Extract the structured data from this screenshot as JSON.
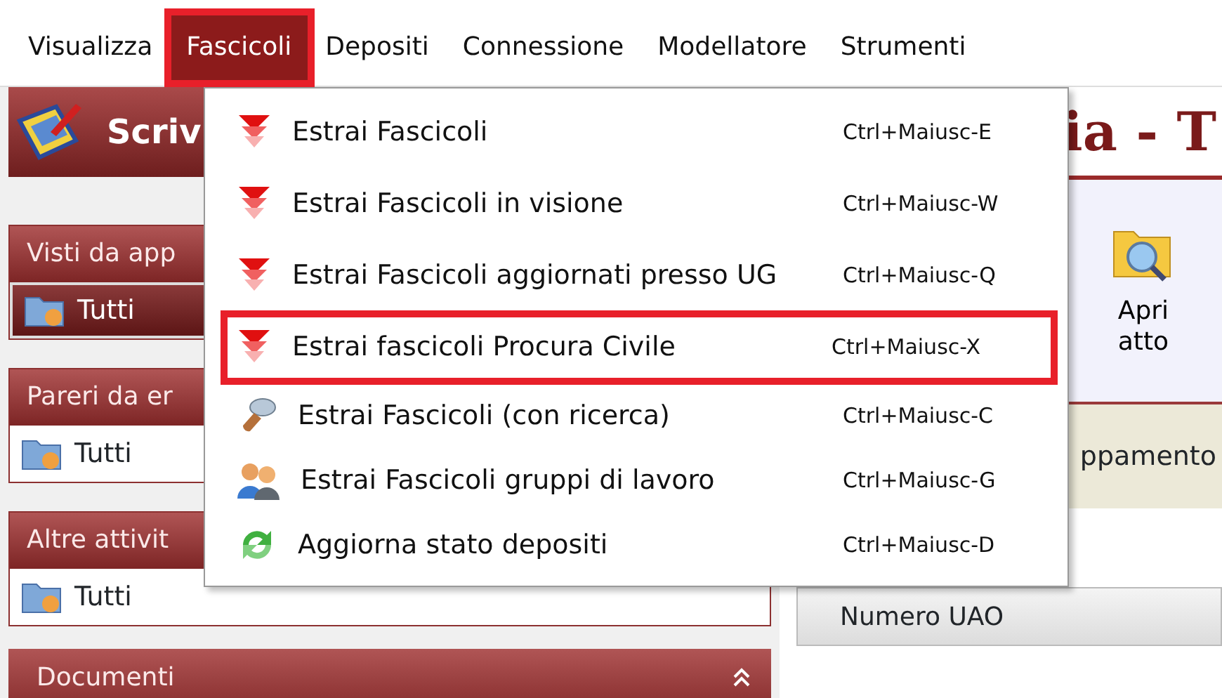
{
  "menu_bar": [
    {
      "label": "Visualizza",
      "selected": false,
      "annotated": false
    },
    {
      "label": "Fascicoli",
      "selected": true,
      "annotated": true
    },
    {
      "label": "Depositi",
      "selected": false,
      "annotated": false
    },
    {
      "label": "Connessione",
      "selected": false,
      "annotated": false
    },
    {
      "label": "Modellatore",
      "selected": false,
      "annotated": false
    },
    {
      "label": "Strumenti",
      "selected": false,
      "annotated": false
    }
  ],
  "dropdown": [
    {
      "label": "Estrai Fascicoli",
      "shortcut": "Ctrl+Maiusc-E",
      "kind": "extract",
      "annotated": false
    },
    {
      "label": "Estrai Fascicoli in visione",
      "shortcut": "Ctrl+Maiusc-W",
      "kind": "extract",
      "annotated": false
    },
    {
      "label": "Estrai Fascicoli aggiornati presso UG",
      "shortcut": "Ctrl+Maiusc-Q",
      "kind": "extract",
      "annotated": false
    },
    {
      "label": "Estrai fascicoli Procura Civile",
      "shortcut": "Ctrl+Maiusc-X",
      "kind": "extract",
      "annotated": true
    },
    {
      "label": "Estrai Fascicoli (con ricerca)",
      "shortcut": "Ctrl+Maiusc-C",
      "kind": "search",
      "annotated": false
    },
    {
      "label": "Estrai Fascicoli gruppi di lavoro",
      "shortcut": "Ctrl+Maiusc-G",
      "kind": "group",
      "annotated": false
    },
    {
      "label": "Aggiorna stato depositi",
      "shortcut": "Ctrl+Maiusc-D",
      "kind": "refresh",
      "annotated": false
    }
  ],
  "sidebar": {
    "header": "Scriv",
    "sections": [
      {
        "title": "Visti da app",
        "item": "Tutti",
        "selected": true
      },
      {
        "title": "Pareri da er",
        "item": "Tutti",
        "selected": false
      },
      {
        "title": "Altre attivit",
        "item": "Tutti",
        "selected": false
      }
    ],
    "collapsed_section": "Documenti"
  },
  "main": {
    "title": "ia - T",
    "toolbar_button": "Apri atto",
    "band_text": "ppamento",
    "grid_column": "Numero UAO"
  }
}
